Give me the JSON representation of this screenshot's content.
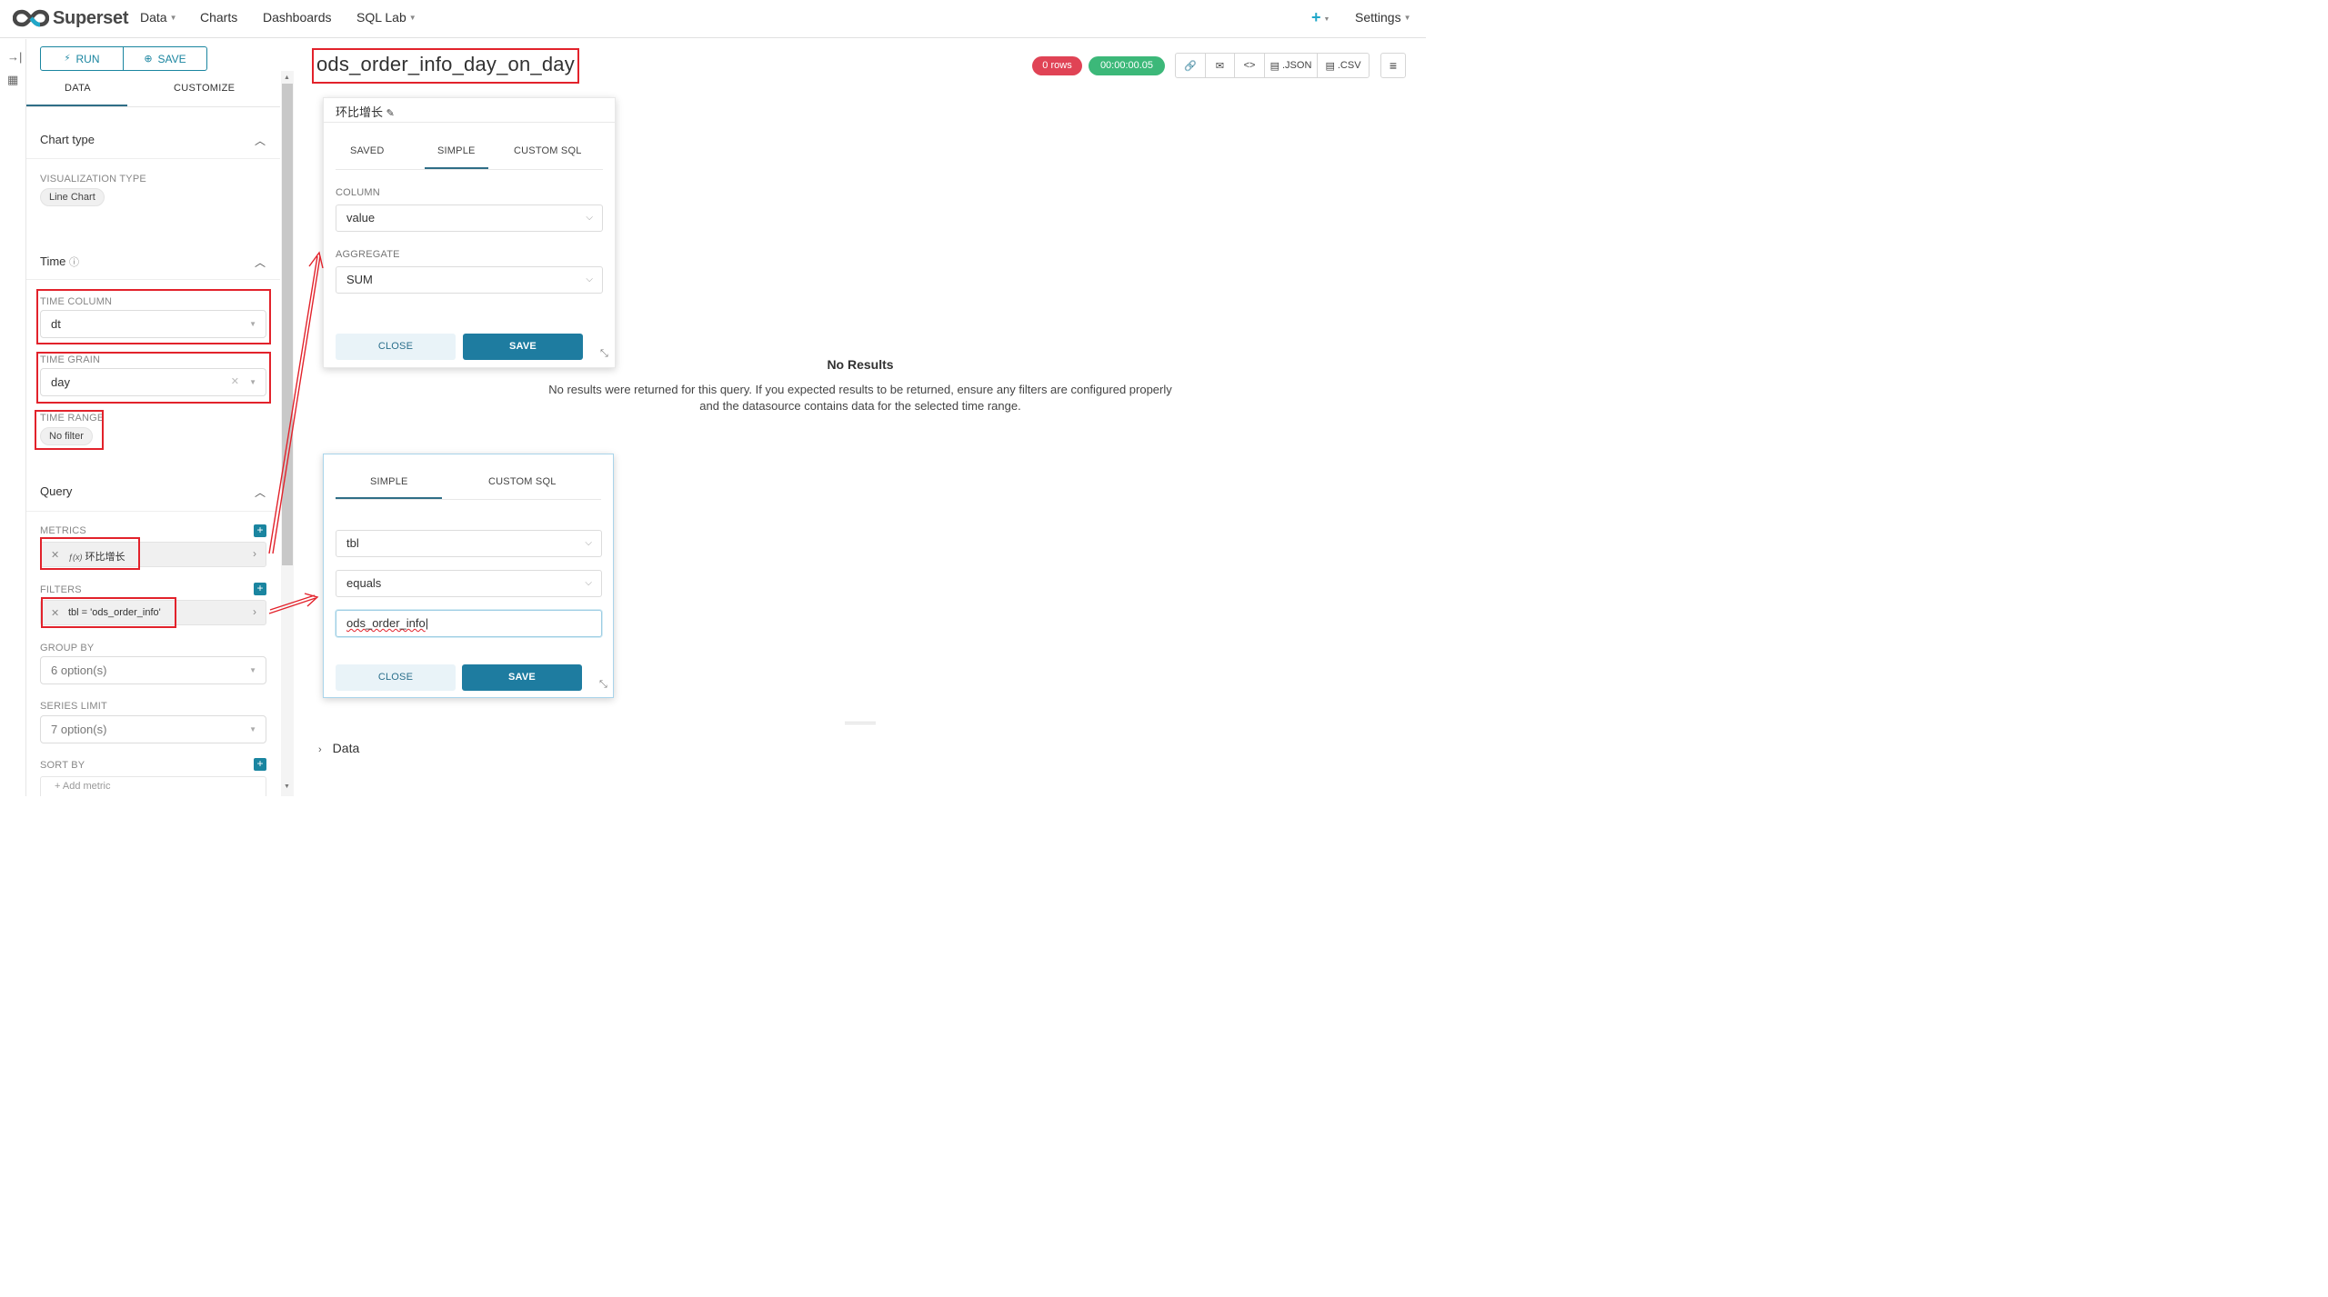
{
  "app": {
    "brand": "Superset",
    "nav": [
      {
        "label": "Data",
        "dropdown": true
      },
      {
        "label": "Charts",
        "dropdown": false
      },
      {
        "label": "Dashboards",
        "dropdown": false
      },
      {
        "label": "SQL Lab",
        "dropdown": true
      }
    ],
    "settings_label": "Settings",
    "add_icon": "plus-icon",
    "accent_color": "#20a7c9"
  },
  "sidebar_icons": [
    "expand-right-icon",
    "table-icon"
  ],
  "control_panel": {
    "run_label": "RUN",
    "save_label": "SAVE",
    "tabs": [
      "DATA",
      "CUSTOMIZE"
    ],
    "active_tab": "DATA",
    "chart_type": {
      "title": "Chart type",
      "viz_label": "VISUALIZATION TYPE",
      "viz_value": "Line Chart"
    },
    "time": {
      "title": "Time",
      "time_column_label": "TIME COLUMN",
      "time_column_value": "dt",
      "time_grain_label": "TIME GRAIN",
      "time_grain_value": "day",
      "time_range_label": "TIME RANGE",
      "time_range_value": "No filter"
    },
    "query": {
      "title": "Query",
      "metrics_label": "METRICS",
      "metric_value": "环比增长",
      "metric_prefix": "ƒ(x)",
      "filters_label": "FILTERS",
      "filter_value": "tbl = 'ods_order_info'",
      "group_by_label": "GROUP BY",
      "group_by_value": "6 option(s)",
      "series_limit_label": "SERIES LIMIT",
      "series_limit_value": "7 option(s)",
      "sort_by_label": "SORT BY",
      "add_metric_placeholder": "Add metric"
    }
  },
  "chart": {
    "title": "ods_order_info_day_on_day",
    "rows_badge": "0 rows",
    "time_badge": "00:00:00.05",
    "rows_badge_color": "#e04355",
    "time_badge_color": "#3cb879",
    "toolbar": {
      "link_icon": "link-icon",
      "email_icon": "email-icon",
      "embed_icon": "code-icon",
      "json_label": ".JSON",
      "csv_label": ".CSV",
      "menu_icon": "menu-icon"
    },
    "no_results_title": "No Results",
    "no_results_line1": "No results were returned for this query. If you expected results to be returned, ensure any filters are configured properly",
    "no_results_line2": "and the datasource contains data for the selected time range.",
    "data_section_label": "Data"
  },
  "metric_popover": {
    "title": "环比增长",
    "tabs": [
      "SAVED",
      "SIMPLE",
      "CUSTOM SQL"
    ],
    "active_tab": "SIMPLE",
    "column_label": "COLUMN",
    "column_value": "value",
    "aggregate_label": "AGGREGATE",
    "aggregate_value": "SUM",
    "close_label": "CLOSE",
    "save_label": "SAVE"
  },
  "filter_popover": {
    "tabs": [
      "SIMPLE",
      "CUSTOM SQL"
    ],
    "active_tab": "SIMPLE",
    "subject_value": "tbl",
    "operator_value": "equals",
    "comparator_value": "ods_order_info",
    "close_label": "CLOSE",
    "save_label": "SAVE"
  },
  "annotation_color": "#e2222b"
}
